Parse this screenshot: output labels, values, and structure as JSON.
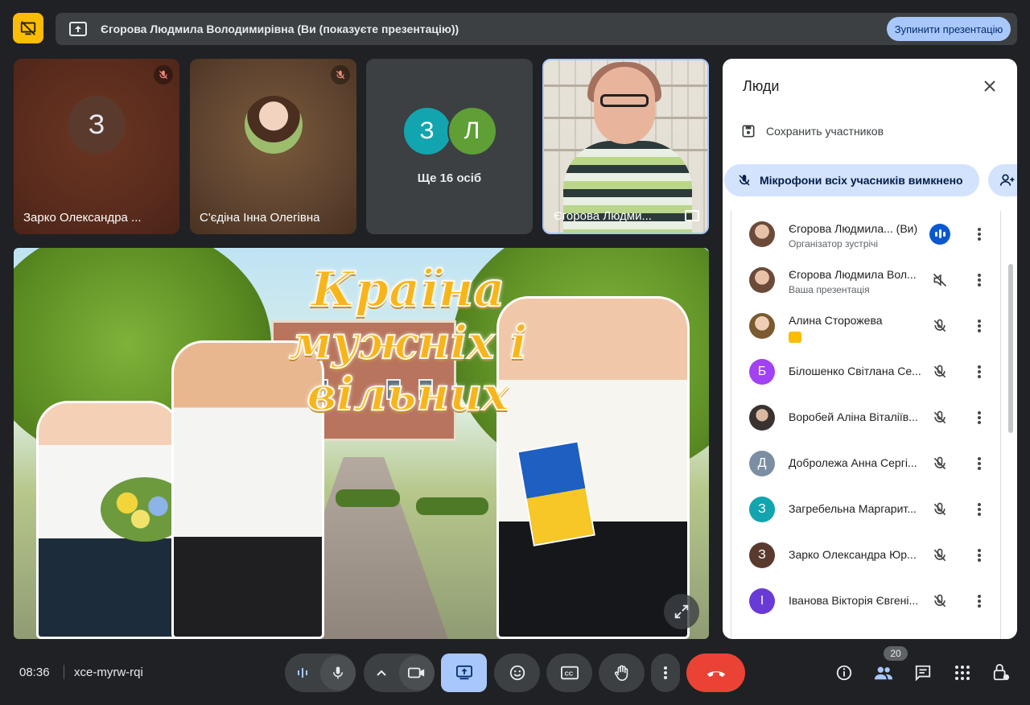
{
  "banner": {
    "presenter_text": "Єгорова Людмила Володимирівна (Ви (показуєте презентацію))",
    "stop_label": "Зупинити презентацію",
    "accent": "#fbbc04"
  },
  "tiles": [
    {
      "name": "Зарко Олександра ...",
      "initial": "З",
      "muted": true
    },
    {
      "name": "С'єдіна Інна Олегівна",
      "muted": true
    },
    {
      "more_text": "Ще 16 осіб",
      "initials": [
        "З",
        "Л"
      ]
    },
    {
      "name": "Єгорова Людми..."
    }
  ],
  "slide": {
    "title_line1": "Країна",
    "title_line2": "мужніх і",
    "title_line3": "вільних"
  },
  "panel": {
    "title": "Люди",
    "save_label": "Сохранить участников",
    "mute_all_label": "Мікрофони всіх учасників вимкнено",
    "participants": [
      {
        "name": "Єгорова Людмила...  (Ви)",
        "sub": "Організатор зустрічі",
        "avatar": "photo",
        "mic": "speaking"
      },
      {
        "name": "Єгорова Людмила Вол...",
        "sub": "Ваша презентація",
        "avatar": "photo",
        "mic": "muted-volume"
      },
      {
        "name": "Алина Сторожева",
        "sub": "",
        "avatar": "photo",
        "mic": "muted"
      },
      {
        "name": "Білошенко Світлана Се...",
        "initial": "Б",
        "color": "#a142f4",
        "mic": "muted"
      },
      {
        "name": "Воробей Аліна Віталіїв...",
        "avatar": "photo",
        "mic": "muted"
      },
      {
        "name": "Добролежа Анна Сергі...",
        "initial": "Д",
        "color": "#7c8ea3",
        "mic": "muted"
      },
      {
        "name": "Загребельна Маргарит...",
        "initial": "З",
        "color": "#12a4af",
        "mic": "muted"
      },
      {
        "name": "Зарко Олександра Юр...",
        "initial": "З",
        "color": "#5b3a2e",
        "mic": "muted"
      },
      {
        "name": "Іванова Вікторія Євгені...",
        "initial": "І",
        "color": "#6a3ad6",
        "mic": "muted"
      }
    ]
  },
  "footer": {
    "time": "08:36",
    "meeting_code": "xce-myrw-rqi",
    "participant_count": "20"
  }
}
